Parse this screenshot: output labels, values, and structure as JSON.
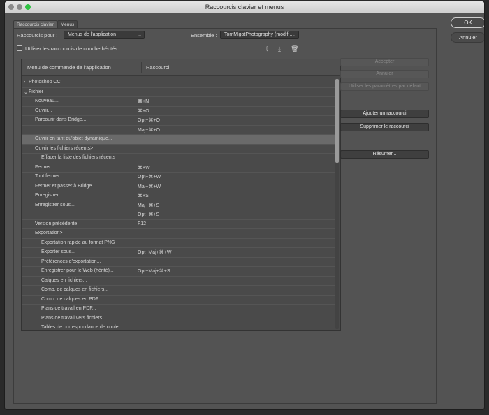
{
  "window": {
    "title": "Raccourcis clavier et menus"
  },
  "tabs": [
    {
      "label": "Raccourcis clavier",
      "active": true
    },
    {
      "label": "Menus",
      "active": false
    }
  ],
  "options": {
    "shortcuts_for_label": "Raccourcis pour :",
    "shortcuts_for_value": "Menus de l'application",
    "set_label": "Ensemble :",
    "set_value": "TomMigotPhotography (modif...",
    "legacy_checkbox_label": "Utiliser les raccourcis de couche hérités",
    "legacy_checked": false
  },
  "toolbar_icons": [
    "save-set-icon",
    "save-as-icon",
    "trash-icon"
  ],
  "table": {
    "col_command": "Menu de commande de l'application",
    "col_shortcut": "Raccourci",
    "rows": [
      {
        "cmd": "Photoshop CC",
        "key": "",
        "indent": 0,
        "disclosure": "›"
      },
      {
        "cmd": "Fichier",
        "key": "",
        "indent": 0,
        "disclosure": "⌄"
      },
      {
        "cmd": "Nouveau...",
        "key": "⌘+N",
        "indent": 1,
        "disclosure": ""
      },
      {
        "cmd": "Ouvrir...",
        "key": "⌘+O",
        "indent": 1,
        "disclosure": ""
      },
      {
        "cmd": "Parcourir dans Bridge...",
        "key": "Opt+⌘+O",
        "indent": 1,
        "disclosure": ""
      },
      {
        "cmd": "",
        "key": "Maj+⌘+O",
        "indent": 1,
        "disclosure": ""
      },
      {
        "cmd": "Ouvrir en tant qu'objet dynamique...",
        "key": "",
        "indent": 1,
        "disclosure": "",
        "selected": true
      },
      {
        "cmd": "Ouvrir les fichiers récents>",
        "key": "",
        "indent": 1,
        "disclosure": ""
      },
      {
        "cmd": "Effacer la liste des fichiers récents",
        "key": "",
        "indent": 2,
        "disclosure": ""
      },
      {
        "cmd": "Fermer",
        "key": "⌘+W",
        "indent": 1,
        "disclosure": ""
      },
      {
        "cmd": "Tout fermer",
        "key": "Opt+⌘+W",
        "indent": 1,
        "disclosure": ""
      },
      {
        "cmd": "Fermer et passer à Bridge...",
        "key": "Maj+⌘+W",
        "indent": 1,
        "disclosure": ""
      },
      {
        "cmd": "Enregistrer",
        "key": "⌘+S",
        "indent": 1,
        "disclosure": ""
      },
      {
        "cmd": "Enregistrer sous...",
        "key": "Maj+⌘+S",
        "indent": 1,
        "disclosure": ""
      },
      {
        "cmd": "",
        "key": "Opt+⌘+S",
        "indent": 1,
        "disclosure": ""
      },
      {
        "cmd": "Version précédente",
        "key": "F12",
        "indent": 1,
        "disclosure": ""
      },
      {
        "cmd": "Exportation>",
        "key": "",
        "indent": 1,
        "disclosure": ""
      },
      {
        "cmd": "Exportation rapide au format PNG",
        "key": "",
        "indent": 2,
        "disclosure": ""
      },
      {
        "cmd": "Exporter sous...",
        "key": "Opt+Maj+⌘+W",
        "indent": 2,
        "disclosure": ""
      },
      {
        "cmd": "Préférences d'exportation...",
        "key": "",
        "indent": 2,
        "disclosure": ""
      },
      {
        "cmd": "Enregistrer pour le Web (hérité)...",
        "key": "Opt+Maj+⌘+S",
        "indent": 2,
        "disclosure": ""
      },
      {
        "cmd": "Calques en fichiers...",
        "key": "",
        "indent": 2,
        "disclosure": ""
      },
      {
        "cmd": "Comp. de calques en fichiers...",
        "key": "",
        "indent": 2,
        "disclosure": ""
      },
      {
        "cmd": "Comp. de calques en PDF...",
        "key": "",
        "indent": 2,
        "disclosure": ""
      },
      {
        "cmd": "Plans de travail en PDF...",
        "key": "",
        "indent": 2,
        "disclosure": ""
      },
      {
        "cmd": "Plans de travail vers fichiers...",
        "key": "",
        "indent": 2,
        "disclosure": ""
      },
      {
        "cmd": "Tables de correspondance de coule...",
        "key": "",
        "indent": 2,
        "disclosure": ""
      }
    ]
  },
  "side_buttons": {
    "accept": "Accepter",
    "undo": "Annuler",
    "use_default": "Utiliser les paramètres par défaut",
    "add_shortcut": "Ajouter un raccourci",
    "delete_shortcut": "Supprimer le raccourci",
    "summarize": "Résumer..."
  },
  "dialog_buttons": {
    "ok": "OK",
    "cancel": "Annuler"
  }
}
